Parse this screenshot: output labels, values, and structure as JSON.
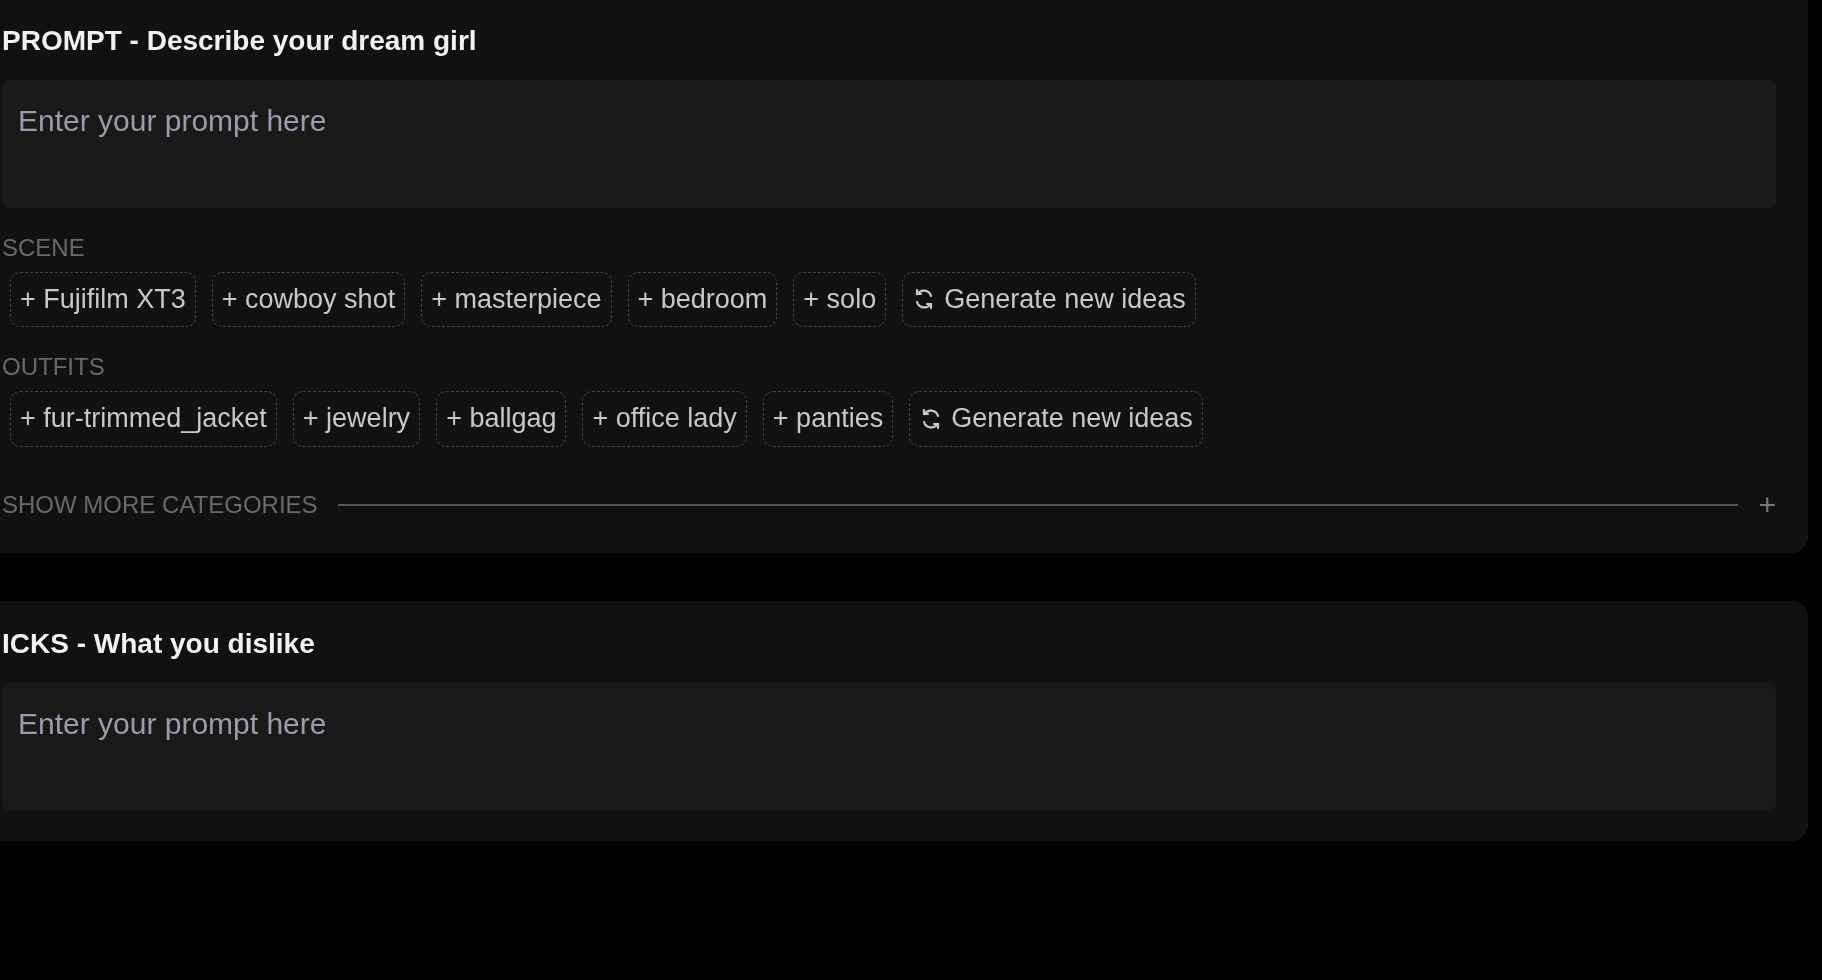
{
  "sections": [
    {
      "title": "PROMPT - Describe your dream girl",
      "placeholder": "Enter your prompt here",
      "categories": [
        {
          "label": "SCENE",
          "chips": [
            {
              "kind": "tag",
              "label": "+ Fujifilm XT3"
            },
            {
              "kind": "tag",
              "label": "+ cowboy shot"
            },
            {
              "kind": "tag",
              "label": "+ masterpiece"
            },
            {
              "kind": "tag",
              "label": "+ bedroom"
            },
            {
              "kind": "tag",
              "label": "+ solo"
            },
            {
              "kind": "generate",
              "label": "Generate new ideas"
            }
          ]
        },
        {
          "label": "OUTFITS",
          "chips": [
            {
              "kind": "tag",
              "label": "+ fur-trimmed_jacket"
            },
            {
              "kind": "tag",
              "label": "+ jewelry"
            },
            {
              "kind": "tag",
              "label": "+ ballgag"
            },
            {
              "kind": "tag",
              "label": "+ office lady"
            },
            {
              "kind": "tag",
              "label": "+ panties"
            },
            {
              "kind": "generate",
              "label": "Generate new ideas"
            }
          ]
        }
      ],
      "show_more": {
        "label": "SHOW MORE CATEGORIES",
        "icon": "+"
      }
    },
    {
      "title": "ICKS - What you dislike",
      "placeholder": "Enter your prompt here"
    }
  ]
}
